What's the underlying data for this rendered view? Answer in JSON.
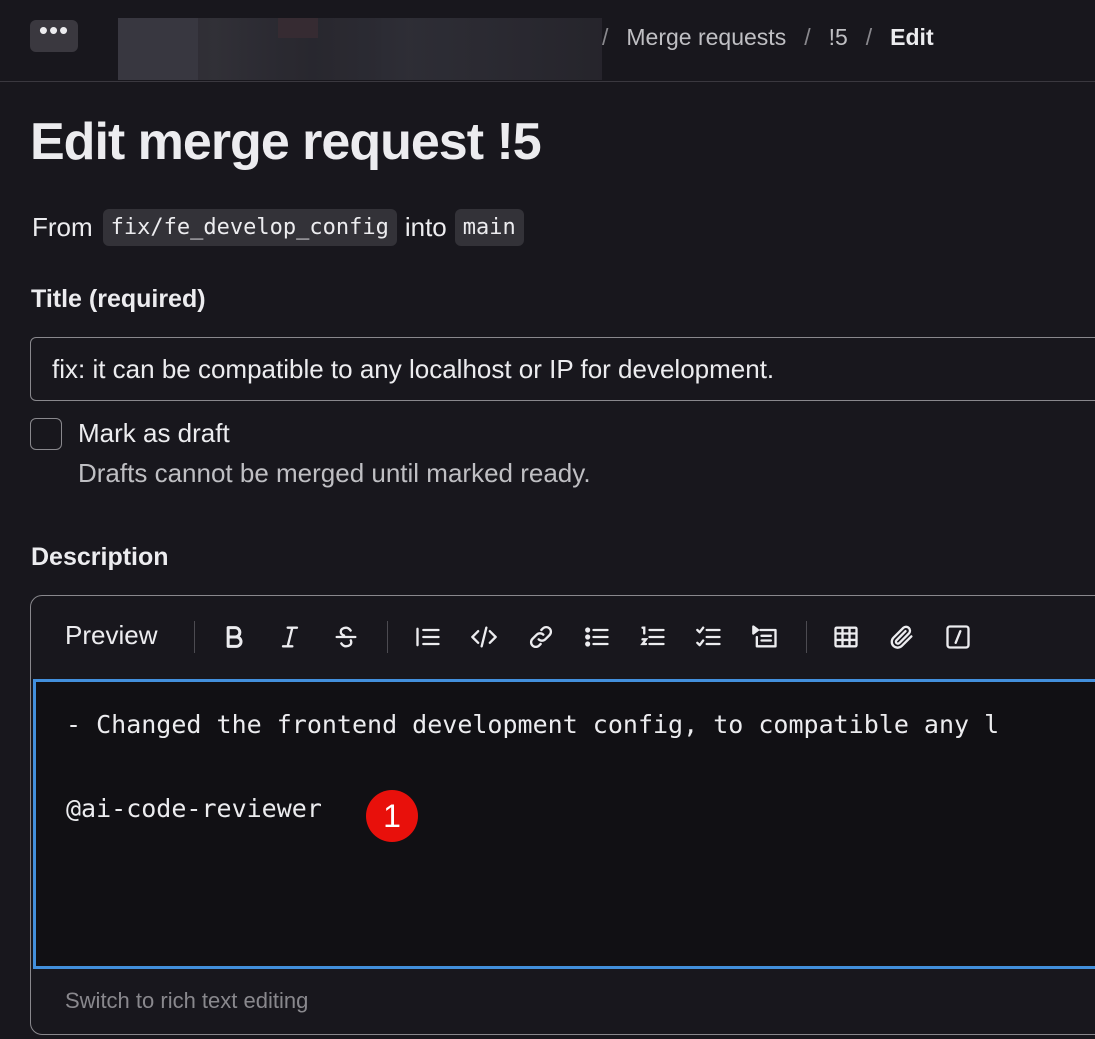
{
  "topbar": {
    "more_label": "•••",
    "breadcrumbs": [
      {
        "label": "Merge requests"
      },
      {
        "label": "!5"
      },
      {
        "label": "Edit"
      }
    ],
    "separator": "/"
  },
  "page": {
    "title": "Edit merge request !5",
    "from_text": "From",
    "source_branch": "fix/fe_develop_config",
    "into_text": "into",
    "target_branch": "main"
  },
  "form": {
    "title_label": "Title (required)",
    "title_value": "fix: it can be compatible to any localhost or IP for development.",
    "draft_label": "Mark as draft",
    "draft_help": "Drafts cannot be merged until marked ready.",
    "draft_checked": false,
    "description_label": "Description"
  },
  "editor": {
    "preview_label": "Preview",
    "toolbar_icons": [
      "bold-icon",
      "italic-icon",
      "strikethrough-icon",
      "quote-icon",
      "code-icon",
      "link-icon",
      "bulleted-list-icon",
      "numbered-list-icon",
      "task-list-icon",
      "collapsible-section-icon",
      "table-icon",
      "attach-file-icon",
      "quick-actions-icon"
    ],
    "lines": [
      "- Changed the frontend development config, to compatible any l",
      "@ai-code-reviewer"
    ],
    "annotation": "1",
    "annotation_color": "#e8100b",
    "focus_color": "#428fdc",
    "footer_link": "Switch to rich text editing"
  }
}
